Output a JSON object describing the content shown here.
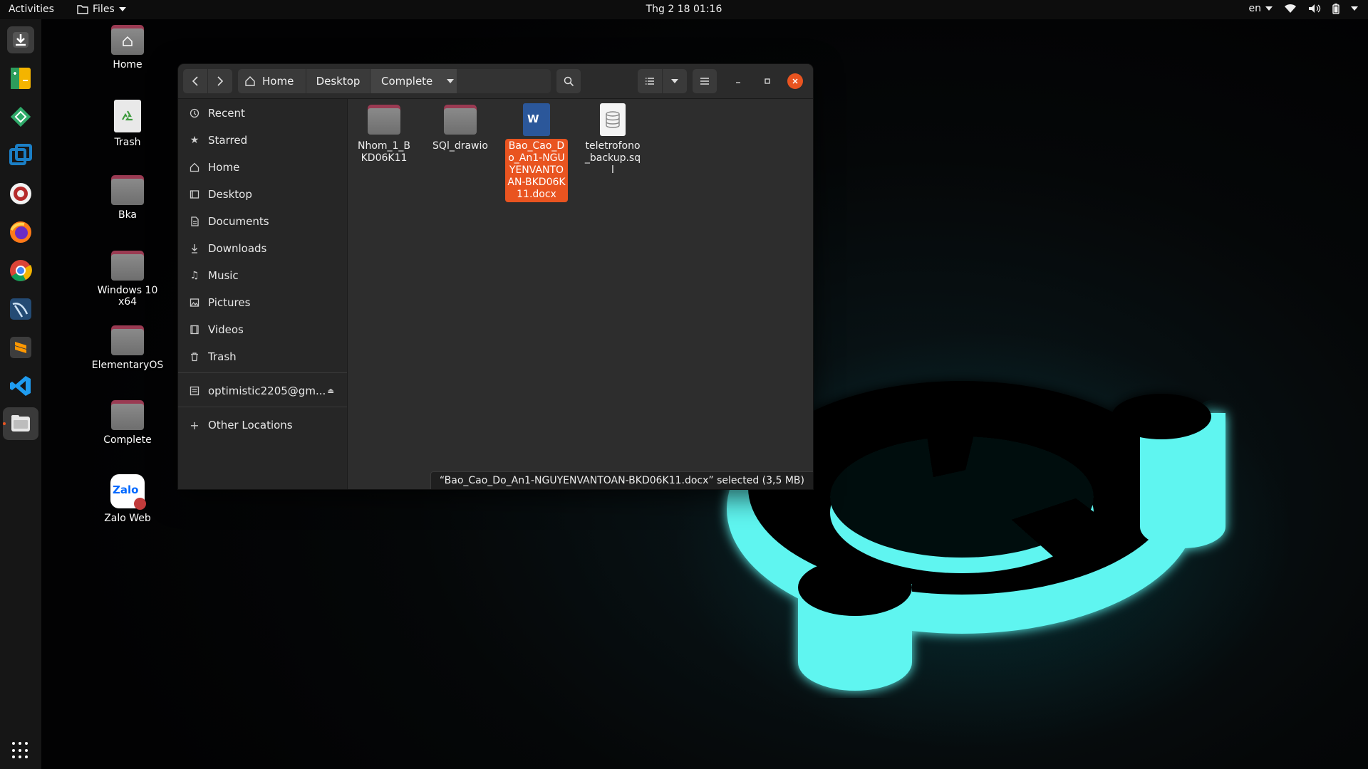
{
  "topbar": {
    "activities": "Activities",
    "app_menu": "Files",
    "clock": "Thg 2 18  01:16",
    "keyboard_layout": "en",
    "tray_icons": [
      "wifi-icon",
      "volume-icon",
      "battery-icon"
    ]
  },
  "dock": {
    "items": [
      "downloader",
      "spreadsheet",
      "vpn",
      "virtualbox",
      "recorder",
      "firefox",
      "chrome",
      "mysql-workbench",
      "sublime-text",
      "vscode",
      "files"
    ],
    "show_apps": "apps-grid-icon"
  },
  "desktop": {
    "icons": [
      {
        "label": "Home",
        "kind": "home"
      },
      {
        "label": "Trash",
        "kind": "trash"
      },
      {
        "label": "Bka",
        "kind": "folder"
      },
      {
        "label": "Windows 10 x64",
        "kind": "folder"
      },
      {
        "label": "ElementaryOS",
        "kind": "folder"
      },
      {
        "label": "Complete",
        "kind": "folder"
      },
      {
        "label": "Zalo Web",
        "kind": "zalo"
      }
    ],
    "zalo_badge": "Zalo"
  },
  "window": {
    "breadcrumb": [
      "Home",
      "Desktop",
      "Complete"
    ],
    "sidebar": [
      {
        "label": "Recent",
        "icon": "clock-icon"
      },
      {
        "label": "Starred",
        "icon": "star-icon"
      },
      {
        "label": "Home",
        "icon": "home-icon"
      },
      {
        "label": "Desktop",
        "icon": "desktop-icon"
      },
      {
        "label": "Documents",
        "icon": "document-icon"
      },
      {
        "label": "Downloads",
        "icon": "download-icon"
      },
      {
        "label": "Music",
        "icon": "music-icon"
      },
      {
        "label": "Pictures",
        "icon": "picture-icon"
      },
      {
        "label": "Videos",
        "icon": "video-icon"
      },
      {
        "label": "Trash",
        "icon": "trash-icon"
      }
    ],
    "account": "optimistic2205@gm...",
    "other_locations": "Other Locations",
    "files": [
      {
        "name": "Nhom_1_BKD06K11",
        "kind": "folder",
        "selected": false
      },
      {
        "name": "SQl_drawio",
        "kind": "folder",
        "selected": false
      },
      {
        "name": "Bao_Cao_Do_An1-NGUYENVANTOAN-BKD06K11.docx",
        "kind": "docx",
        "selected": true
      },
      {
        "name": "teletrofono_backup.sql",
        "kind": "sql",
        "selected": false
      }
    ],
    "status": "“Bao_Cao_Do_An1-NGUYENVANTOAN-BKD06K11.docx” selected  (3,5 MB)"
  },
  "colors": {
    "accent": "#e95420",
    "folder_tab": "#9a3a52",
    "glow": "#5ff5f0"
  }
}
